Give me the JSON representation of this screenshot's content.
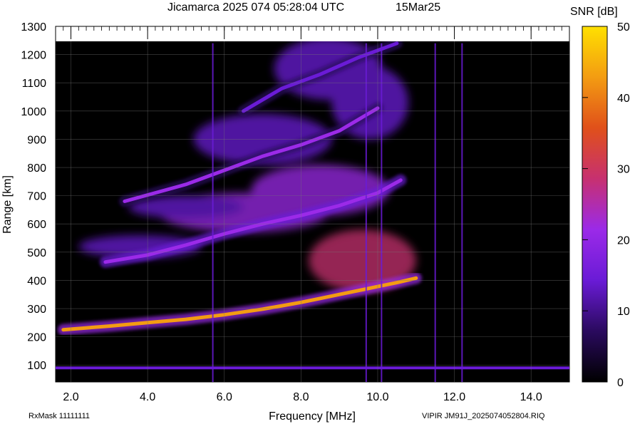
{
  "header": {
    "title": "Jicamarca 2025 074 05:28:04 UTC",
    "date": "15Mar25"
  },
  "footer": {
    "rx_mask": "RxMask 11111111",
    "file_label": "VIPIR  JM91J_2025074052804.RIQ"
  },
  "colorbar": {
    "label": "SNR [dB]",
    "range": [
      0,
      50
    ],
    "ticks": [
      "0",
      "10",
      "20",
      "30",
      "40",
      "50"
    ],
    "colors": [
      "#000000",
      "#2a0a5e",
      "#6a1bd6",
      "#9b2ae8",
      "#c73070",
      "#e0501a",
      "#f39c12",
      "#ffe000"
    ]
  },
  "chart_data": {
    "type": "heatmap",
    "xlabel": "Frequency [MHz]",
    "ylabel": "Range [km]",
    "xlim": [
      1.6,
      15.0
    ],
    "ylim": [
      40,
      1300
    ],
    "x_ticks": [
      "2.0",
      "4.0",
      "6.0",
      "8.0",
      "10.0",
      "12.0",
      "14.0"
    ],
    "y_ticks": [
      "100",
      "200",
      "300",
      "400",
      "500",
      "600",
      "700",
      "800",
      "900",
      "1000",
      "1100",
      "1200",
      "1300"
    ],
    "value_label": "SNR [dB]",
    "traces": [
      {
        "name": "E layer",
        "freq": [
          1.6,
          15.0
        ],
        "range": [
          90,
          90
        ],
        "snr": 12
      },
      {
        "name": "F layer trace",
        "freq": [
          1.8,
          3,
          4,
          5,
          6,
          7,
          7.5,
          8,
          8.5,
          9,
          9.5,
          10,
          10.5,
          11
        ],
        "range": [
          225,
          238,
          250,
          262,
          278,
          298,
          310,
          322,
          336,
          350,
          364,
          378,
          392,
          408
        ],
        "snr": 40
      },
      {
        "name": "second hop",
        "freq": [
          2.9,
          4,
          5,
          6,
          7,
          8,
          9,
          10,
          10.6
        ],
        "range": [
          465,
          490,
          525,
          565,
          600,
          630,
          665,
          710,
          755
        ],
        "snr": 22
      },
      {
        "name": "third hop",
        "freq": [
          3.4,
          5,
          6,
          7,
          8,
          9,
          10
        ],
        "range": [
          680,
          740,
          790,
          840,
          880,
          930,
          1010
        ],
        "snr": 18
      },
      {
        "name": "fourth hop",
        "freq": [
          6.5,
          7.5,
          8.5,
          9.5,
          10.5
        ],
        "range": [
          1000,
          1080,
          1130,
          1190,
          1240
        ],
        "snr": 12
      }
    ],
    "spikes_mhz": [
      5.7,
      9.7,
      10.1,
      11.5,
      12.2
    ]
  }
}
